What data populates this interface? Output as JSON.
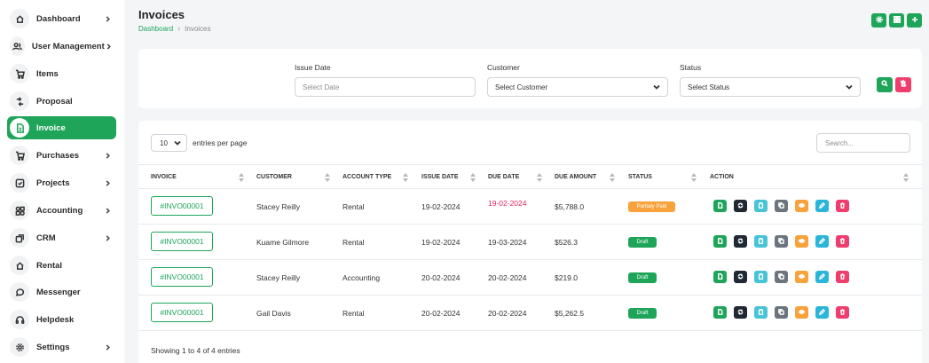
{
  "sidebar": {
    "items": [
      {
        "label": "Dashboard",
        "icon": "home-icon",
        "chevron": true
      },
      {
        "label": "User Management",
        "icon": "users-icon",
        "chevron": true
      },
      {
        "label": "Items",
        "icon": "cart-icon",
        "chevron": false
      },
      {
        "label": "Proposal",
        "icon": "proposal-icon",
        "chevron": false
      },
      {
        "label": "Invoice",
        "icon": "file-icon",
        "chevron": false,
        "active": true
      },
      {
        "label": "Purchases",
        "icon": "cart-icon",
        "chevron": true
      },
      {
        "label": "Projects",
        "icon": "checkbox-icon",
        "chevron": true
      },
      {
        "label": "Accounting",
        "icon": "grid-icon",
        "chevron": true
      },
      {
        "label": "CRM",
        "icon": "layers-icon",
        "chevron": true
      },
      {
        "label": "Rental",
        "icon": "home-icon",
        "chevron": false
      },
      {
        "label": "Messenger",
        "icon": "chat-icon",
        "chevron": false
      },
      {
        "label": "Helpdesk",
        "icon": "headset-icon",
        "chevron": false
      },
      {
        "label": "Settings",
        "icon": "gear-icon",
        "chevron": true
      }
    ]
  },
  "header": {
    "title": "Invoices",
    "breadcrumb": {
      "home": "Dashboard",
      "current": "Invoices"
    },
    "actions": [
      "settings-icon",
      "grid-icon",
      "plus-icon"
    ]
  },
  "filters": {
    "issue_date": {
      "label": "Issue Date",
      "placeholder": "Select Date"
    },
    "customer": {
      "label": "Customer",
      "value": "Select Customer"
    },
    "status": {
      "label": "Status",
      "value": "Select Status"
    }
  },
  "table": {
    "per_page_value": "10",
    "per_page_label": "entries per page",
    "search_placeholder": "Search...",
    "columns": [
      "INVOICE",
      "CUSTOMER",
      "ACCOUNT TYPE",
      "ISSUE DATE",
      "DUE DATE",
      "DUE AMOUNT",
      "STATUS",
      "ACTION"
    ],
    "rows": [
      {
        "invoice": "#INVO00001",
        "customer": "Stacey Reilly",
        "account_type": "Rental",
        "issue_date": "19-02-2024",
        "due_date": "19-02-2024",
        "due_amount": "$5,788.0",
        "status": "Partialy Paid"
      },
      {
        "invoice": "#INVO00001",
        "customer": "Kuame Gilmore",
        "account_type": "Rental",
        "issue_date": "19-02-2024",
        "due_date": "19-03-2024",
        "due_amount": "$526.3",
        "status": "Draft"
      },
      {
        "invoice": "#INVO00001",
        "customer": "Stacey Reilly",
        "account_type": "Accounting",
        "issue_date": "20-02-2024",
        "due_date": "20-02-2024",
        "due_amount": "$219.0",
        "status": "Draft"
      },
      {
        "invoice": "#INVO00001",
        "customer": "Gail Davis",
        "account_type": "Rental",
        "issue_date": "20-02-2024",
        "due_date": "20-02-2024",
        "due_amount": "$5,262.5",
        "status": "Draft"
      }
    ],
    "footer": "Showing 1 to 4 of 4 entries"
  },
  "colors": {
    "primary": "#1ea55a",
    "danger": "#ef3e6d",
    "warning": "#f7a23b",
    "info": "#47c4d5",
    "dark": "#1f2833",
    "secondary": "#6c757d",
    "blue": "#2bb5d9"
  }
}
